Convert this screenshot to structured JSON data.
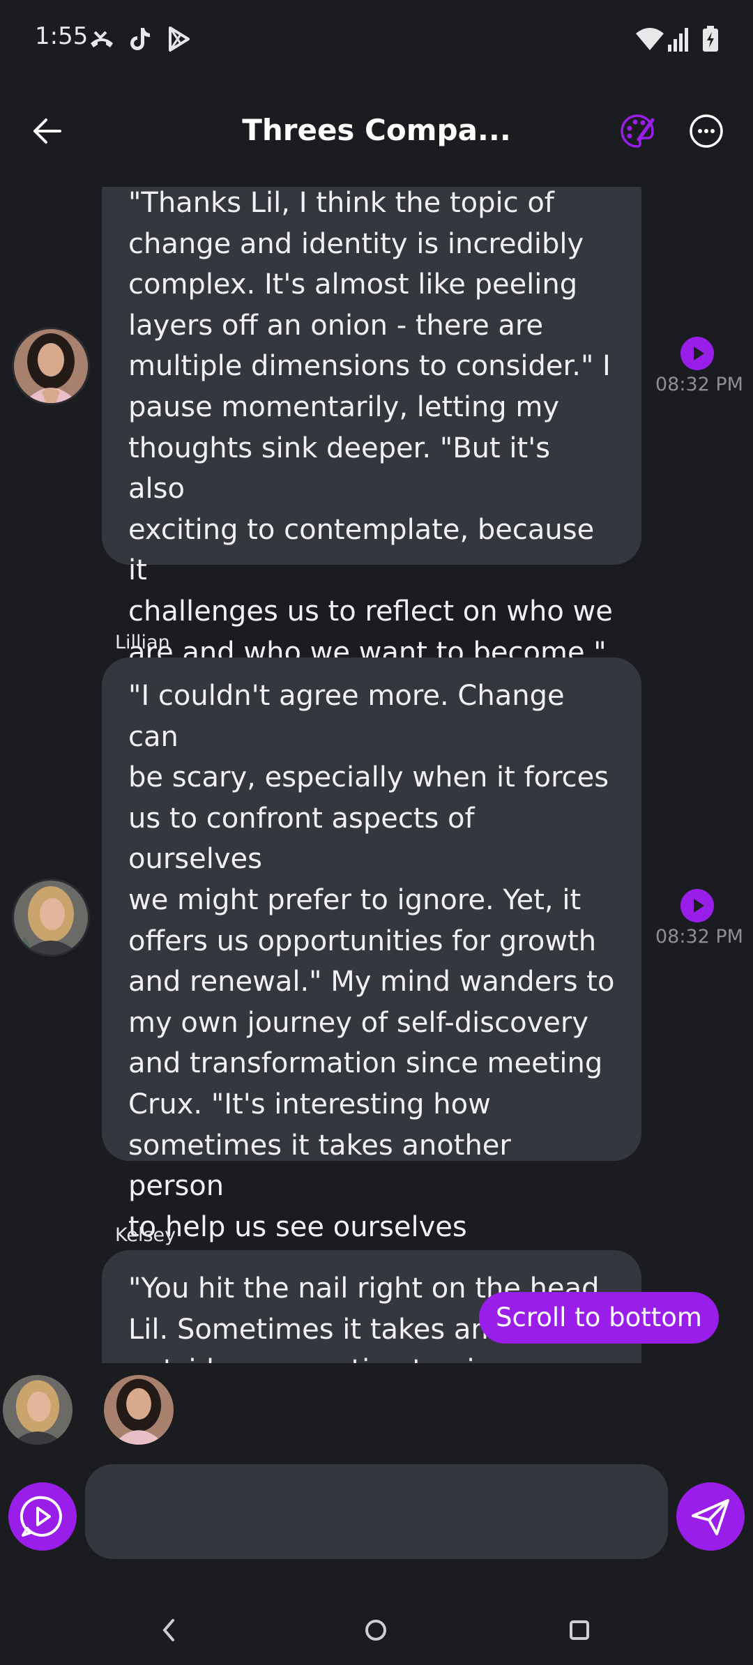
{
  "status_bar": {
    "time": "1:55",
    "left_icons": [
      "missed-call-icon",
      "tiktok-icon",
      "play-store-icon"
    ],
    "right_icons": [
      "wifi-icon",
      "signal-icon",
      "battery-charging-icon"
    ]
  },
  "header": {
    "title": "Threes Compa...",
    "accent_color": "#9a1ee9"
  },
  "messages": [
    {
      "sender": "",
      "text": "\"Thanks Lil, I think the topic of\nchange and identity is incredibly\ncomplex. It's almost like peeling\nlayers off an onion - there are\nmultiple dimensions to consider.\" I\npause momentarily, letting my\nthoughts sink deeper. \"But it's also\nexciting to contemplate, because it\nchallenges us to reflect on who we\nare and who we want to become.\"",
      "time": "08:32 PM"
    },
    {
      "sender": "Lillian",
      "text": "\"I couldn't agree more. Change can\nbe scary, especially when it forces\nus to confront aspects of ourselves\nwe might prefer to ignore. Yet, it\noffers us opportunities for growth\nand renewal.\" My mind wanders to\nmy own journey of self-discovery\nand transformation since meeting\nCrux. \"It's interesting how\nsometimes it takes another person\nto help us see ourselves differently\nand spark change within us.\"",
      "time": "08:32 PM"
    },
    {
      "sender": "Kelsey",
      "text": "\"You hit the nail right on the head\nLil. Sometimes it takes an\noutside perspective to give us",
      "time": ""
    }
  ],
  "scroll_button": {
    "label": "Scroll to bottom"
  },
  "input": {
    "value": "",
    "placeholder": ""
  },
  "navbar": {
    "icons": [
      "back-nav-icon",
      "home-nav-icon",
      "recents-nav-icon"
    ]
  }
}
